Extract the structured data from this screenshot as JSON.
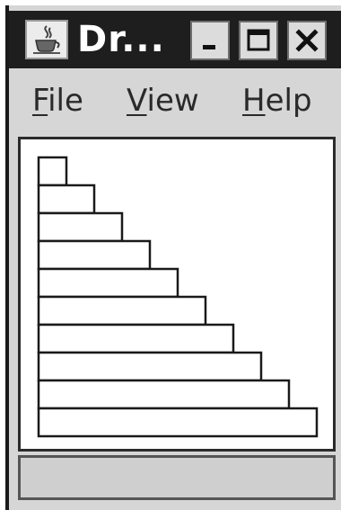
{
  "window": {
    "title": "Dr..."
  },
  "title_bar": {
    "app_icon": "java-coffee-cup-icon",
    "buttons": [
      {
        "name": "minimize",
        "icon": "minimize-icon"
      },
      {
        "name": "maximize",
        "icon": "maximize-icon"
      },
      {
        "name": "close",
        "icon": "close-icon"
      }
    ]
  },
  "menu": {
    "items": [
      {
        "label_first": "F",
        "label_rest": "ile"
      },
      {
        "label_first": "V",
        "label_rest": "iew"
      },
      {
        "label_first": "H",
        "label_rest": "elp"
      }
    ]
  },
  "drawing": {
    "shape": "rectangle",
    "rectangle_count": 10,
    "stroke_color": "#1a1a1a",
    "fill_color": "#ffffff"
  },
  "colors": {
    "title_bar": "#1e1e1e",
    "window_bg": "#d6d6d6",
    "canvas_bg": "#ffffff"
  }
}
